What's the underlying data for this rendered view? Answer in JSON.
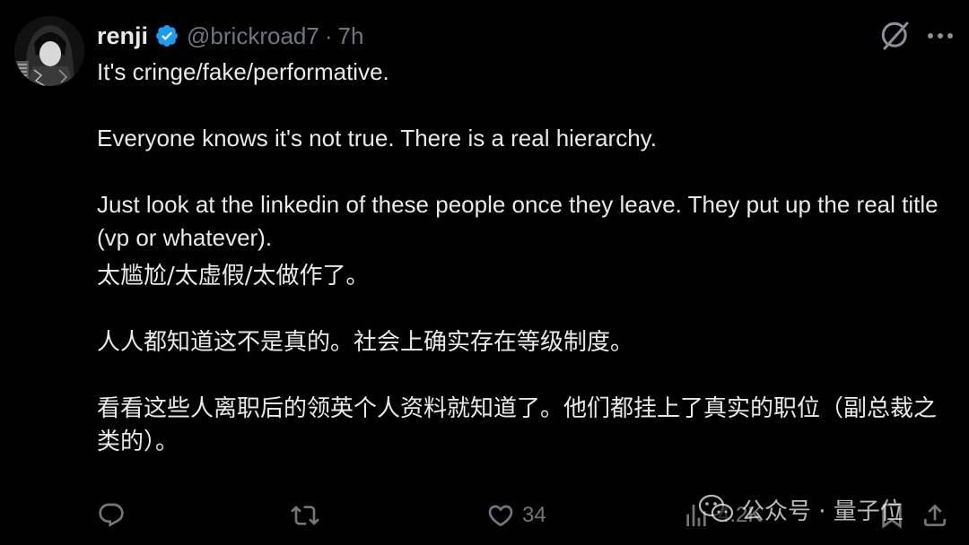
{
  "post": {
    "author_name": "renji",
    "handle": "@brickroad7",
    "separator": "·",
    "time": "7h",
    "lines_en": [
      "It's cringe/fake/performative.",
      "Everyone knows it's not true. There is a real hierarchy.",
      "Just look at the linkedin of these people once they leave. They put up the real title (vp or whatever)."
    ],
    "lines_cn": [
      "太尴尬/太虚假/太做作了。",
      "人人都知道这不是真的。社会上确实存在等级制度。",
      "看看这些人离职后的领英个人资料就知道了。他们都挂上了真实的职位（副总裁之类的）。"
    ]
  },
  "actions": {
    "replies": "",
    "reposts": "",
    "likes": "34",
    "views": "4.2K"
  },
  "watermark": {
    "text": "公众号 · 量子位"
  },
  "icons": {
    "verified": "verified-badge-icon",
    "grok": "grok-icon",
    "more": "more-icon",
    "reply": "reply-icon",
    "repost": "repost-icon",
    "like": "heart-icon",
    "views": "views-icon",
    "bookmark": "bookmark-icon",
    "share": "share-icon"
  },
  "colors": {
    "background": "#000000",
    "text": "#e7e9ea",
    "secondary": "#71767b",
    "verified": "#1d9bf0"
  }
}
